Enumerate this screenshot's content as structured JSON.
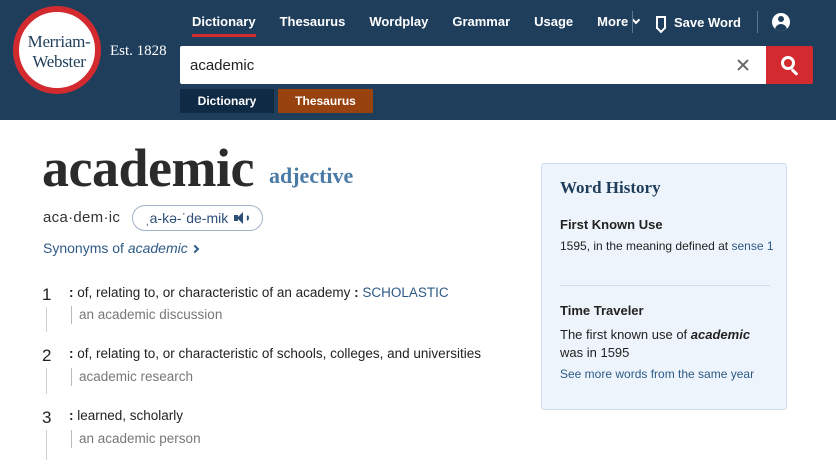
{
  "logo": {
    "line1": "Merriam-",
    "line2": "Webster"
  },
  "est": "Est. 1828",
  "nav": {
    "items": [
      {
        "label": "Dictionary",
        "active": true
      },
      {
        "label": "Thesaurus"
      },
      {
        "label": "Wordplay"
      },
      {
        "label": "Grammar"
      },
      {
        "label": "Usage"
      },
      {
        "label": "More"
      }
    ],
    "save_word": "Save Word"
  },
  "search": {
    "value": "academic",
    "placeholder": ""
  },
  "tabs": {
    "dictionary": "Dictionary",
    "thesaurus": "Thesaurus"
  },
  "entry": {
    "headword": "academic",
    "pos": "adjective",
    "syllables": "aca·dem·ic",
    "pronunciation": "ˌa-kə-ˈde-mik",
    "synonyms_prefix": "Synonyms of ",
    "synonyms_word": "academic"
  },
  "senses": [
    {
      "num": "1",
      "colon": ":",
      "def": " of, relating to, or characteristic of an academy ",
      "colon2": ":",
      "xref": " SCHOLASTIC",
      "example": "an academic discussion"
    },
    {
      "num": "2",
      "colon": ":",
      "def": " of, relating to, or characteristic of schools, colleges, and universities",
      "example": "academic research"
    },
    {
      "num": "3",
      "colon": ":",
      "def": " learned, scholarly",
      "example": "an academic person"
    }
  ],
  "word_history": {
    "title": "Word History",
    "first_known_use_heading": "First Known Use",
    "first_known_use_text": "1595, in the meaning defined at ",
    "first_known_use_link": "sense 1",
    "time_traveler_heading": "Time Traveler",
    "time_traveler_pre": "The first known use of ",
    "time_traveler_word": "academic",
    "time_traveler_post": " was in 1595",
    "more_link": "See more words from the same year"
  },
  "colors": {
    "header_bg": "#1f3e5c",
    "brand_red": "#d22a2e",
    "link_blue": "#2d5a87",
    "thesaurus_orange": "#97420f"
  }
}
